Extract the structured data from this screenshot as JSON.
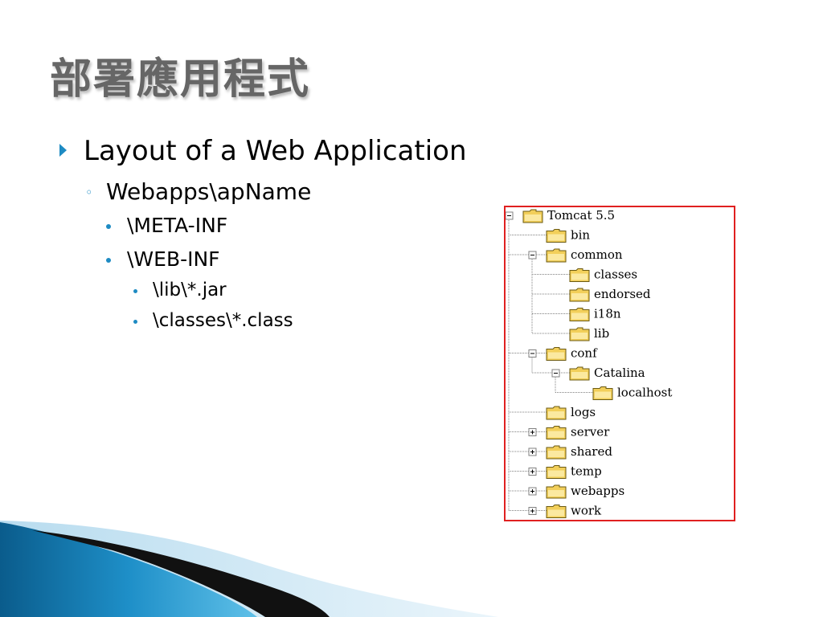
{
  "slide": {
    "title": "部署應用程式",
    "bullets": {
      "l1": "Layout of a Web Application",
      "l2": "Webapps\\apName",
      "l3a": "\\META-INF",
      "l3b": "\\WEB-INF",
      "l4a": "\\lib\\*.jar",
      "l4b": "\\classes\\*.class"
    }
  },
  "tree": {
    "nodes": [
      {
        "label": "Tomcat 5.5",
        "depth": 0,
        "toggle": "minus"
      },
      {
        "label": "bin",
        "depth": 1,
        "toggle": "none"
      },
      {
        "label": "common",
        "depth": 1,
        "toggle": "minus"
      },
      {
        "label": "classes",
        "depth": 2,
        "toggle": "none"
      },
      {
        "label": "endorsed",
        "depth": 2,
        "toggle": "none"
      },
      {
        "label": "i18n",
        "depth": 2,
        "toggle": "none"
      },
      {
        "label": "lib",
        "depth": 2,
        "toggle": "none"
      },
      {
        "label": "conf",
        "depth": 1,
        "toggle": "minus"
      },
      {
        "label": "Catalina",
        "depth": 2,
        "toggle": "minus"
      },
      {
        "label": "localhost",
        "depth": 3,
        "toggle": "none"
      },
      {
        "label": "logs",
        "depth": 1,
        "toggle": "none"
      },
      {
        "label": "server",
        "depth": 1,
        "toggle": "plus"
      },
      {
        "label": "shared",
        "depth": 1,
        "toggle": "plus"
      },
      {
        "label": "temp",
        "depth": 1,
        "toggle": "plus"
      },
      {
        "label": "webapps",
        "depth": 1,
        "toggle": "plus"
      },
      {
        "label": "work",
        "depth": 1,
        "toggle": "plus"
      }
    ],
    "icon": "folder-icon",
    "border_color": "#e02020"
  },
  "theme": {
    "accent": "#1e8bc3",
    "title_color": "#666666"
  }
}
